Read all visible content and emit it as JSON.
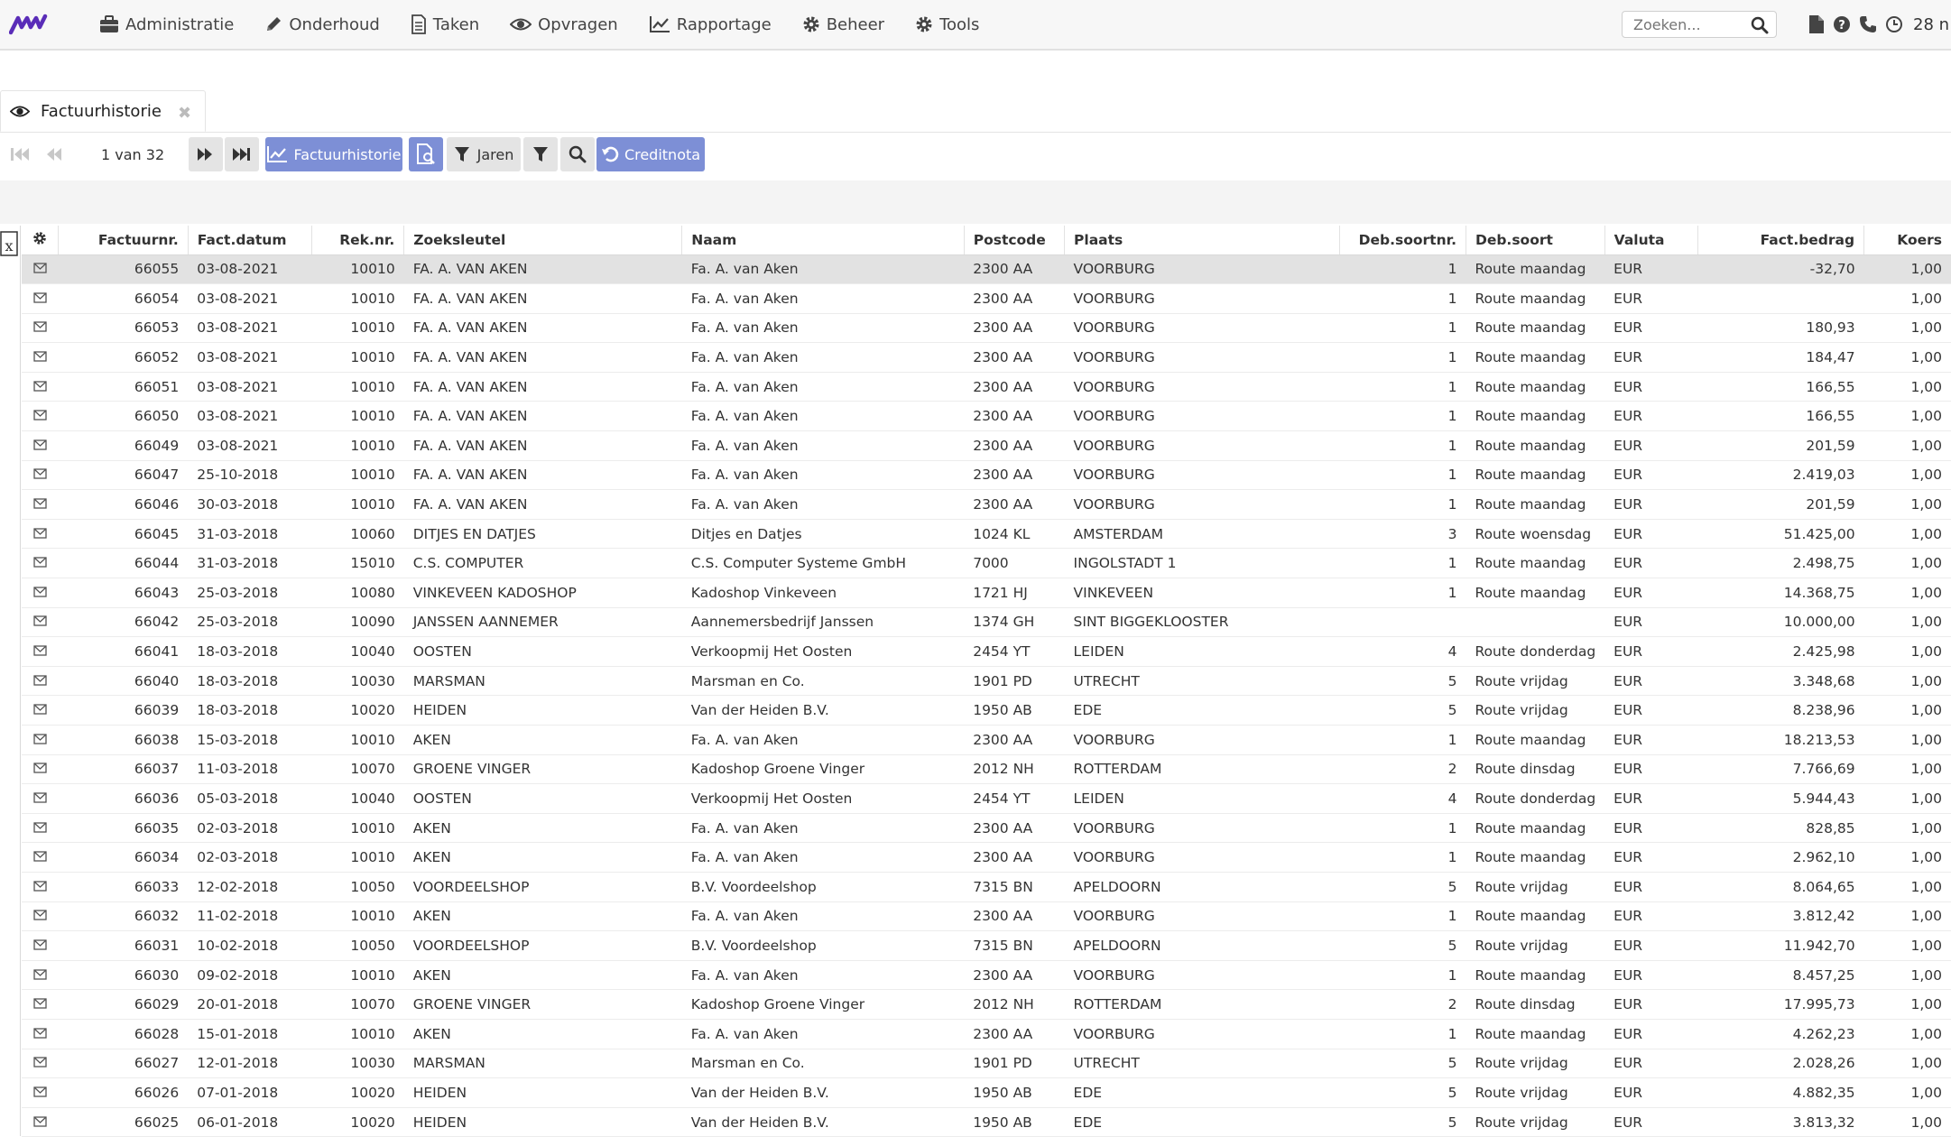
{
  "nav": {
    "items": [
      {
        "label": "Administratie",
        "icon": "briefcase-icon"
      },
      {
        "label": "Onderhoud",
        "icon": "pencil-icon"
      },
      {
        "label": "Taken",
        "icon": "document-icon"
      },
      {
        "label": "Opvragen",
        "icon": "eye-icon"
      },
      {
        "label": "Rapportage",
        "icon": "line-chart-icon"
      },
      {
        "label": "Beheer",
        "icon": "gear-icon"
      },
      {
        "label": "Tools",
        "icon": "gear-icon"
      }
    ],
    "search_placeholder": "Zoeken...",
    "clock_text": "28 n"
  },
  "tab": {
    "label": "Factuurhistorie"
  },
  "toolbar": {
    "page_info": "1 van 32",
    "report_button": "Factuurhistorie",
    "years_button": "Jaren",
    "credit_button": "Creditnota"
  },
  "table": {
    "columns": [
      "Factuurnr.",
      "Fact.datum",
      "Rek.nr.",
      "Zoeksleutel",
      "Naam",
      "Postcode",
      "Plaats",
      "Deb.soortnr.",
      "Deb.soort",
      "Valuta",
      "Fact.bedrag",
      "Koers"
    ],
    "rows": [
      [
        "66055",
        "03-08-2021",
        "10010",
        "FA. A. VAN AKEN",
        "Fa. A. van Aken",
        "2300 AA",
        "VOORBURG",
        "1",
        "Route maandag",
        "EUR",
        "-32,70",
        "1,00"
      ],
      [
        "66054",
        "03-08-2021",
        "10010",
        "FA. A. VAN AKEN",
        "Fa. A. van Aken",
        "2300 AA",
        "VOORBURG",
        "1",
        "Route maandag",
        "EUR",
        "",
        "1,00"
      ],
      [
        "66053",
        "03-08-2021",
        "10010",
        "FA. A. VAN AKEN",
        "Fa. A. van Aken",
        "2300 AA",
        "VOORBURG",
        "1",
        "Route maandag",
        "EUR",
        "180,93",
        "1,00"
      ],
      [
        "66052",
        "03-08-2021",
        "10010",
        "FA. A. VAN AKEN",
        "Fa. A. van Aken",
        "2300 AA",
        "VOORBURG",
        "1",
        "Route maandag",
        "EUR",
        "184,47",
        "1,00"
      ],
      [
        "66051",
        "03-08-2021",
        "10010",
        "FA. A. VAN AKEN",
        "Fa. A. van Aken",
        "2300 AA",
        "VOORBURG",
        "1",
        "Route maandag",
        "EUR",
        "166,55",
        "1,00"
      ],
      [
        "66050",
        "03-08-2021",
        "10010",
        "FA. A. VAN AKEN",
        "Fa. A. van Aken",
        "2300 AA",
        "VOORBURG",
        "1",
        "Route maandag",
        "EUR",
        "166,55",
        "1,00"
      ],
      [
        "66049",
        "03-08-2021",
        "10010",
        "FA. A. VAN AKEN",
        "Fa. A. van Aken",
        "2300 AA",
        "VOORBURG",
        "1",
        "Route maandag",
        "EUR",
        "201,59",
        "1,00"
      ],
      [
        "66047",
        "25-10-2018",
        "10010",
        "FA. A. VAN AKEN",
        "Fa. A. van Aken",
        "2300 AA",
        "VOORBURG",
        "1",
        "Route maandag",
        "EUR",
        "2.419,03",
        "1,00"
      ],
      [
        "66046",
        "30-03-2018",
        "10010",
        "FA. A. VAN AKEN",
        "Fa. A. van Aken",
        "2300 AA",
        "VOORBURG",
        "1",
        "Route maandag",
        "EUR",
        "201,59",
        "1,00"
      ],
      [
        "66045",
        "31-03-2018",
        "10060",
        "DITJES EN DATJES",
        "Ditjes en Datjes",
        "1024 KL",
        "AMSTERDAM",
        "3",
        "Route woensdag",
        "EUR",
        "51.425,00",
        "1,00"
      ],
      [
        "66044",
        "31-03-2018",
        "15010",
        "C.S. COMPUTER",
        "C.S. Computer Systeme GmbH",
        "7000",
        "INGOLSTADT 1",
        "1",
        "Route maandag",
        "EUR",
        "2.498,75",
        "1,00"
      ],
      [
        "66043",
        "25-03-2018",
        "10080",
        "VINKEVEEN KADOSHOP",
        "Kadoshop Vinkeveen",
        "1721 HJ",
        "VINKEVEEN",
        "1",
        "Route maandag",
        "EUR",
        "14.368,75",
        "1,00"
      ],
      [
        "66042",
        "25-03-2018",
        "10090",
        "JANSSEN AANNEMER",
        "Aannemersbedrijf Janssen",
        "1374 GH",
        "SINT BIGGEKLOOSTER",
        "",
        "",
        "EUR",
        "10.000,00",
        "1,00"
      ],
      [
        "66041",
        "18-03-2018",
        "10040",
        "OOSTEN",
        "Verkoopmij Het Oosten",
        "2454 YT",
        "LEIDEN",
        "4",
        "Route donderdag",
        "EUR",
        "2.425,98",
        "1,00"
      ],
      [
        "66040",
        "18-03-2018",
        "10030",
        "MARSMAN",
        "Marsman en Co.",
        "1901 PD",
        "UTRECHT",
        "5",
        "Route vrijdag",
        "EUR",
        "3.348,68",
        "1,00"
      ],
      [
        "66039",
        "18-03-2018",
        "10020",
        "HEIDEN",
        "Van der Heiden B.V.",
        "1950 AB",
        "EDE",
        "5",
        "Route vrijdag",
        "EUR",
        "8.238,96",
        "1,00"
      ],
      [
        "66038",
        "15-03-2018",
        "10010",
        "AKEN",
        "Fa. A. van Aken",
        "2300 AA",
        "VOORBURG",
        "1",
        "Route maandag",
        "EUR",
        "18.213,53",
        "1,00"
      ],
      [
        "66037",
        "11-03-2018",
        "10070",
        "GROENE VINGER",
        "Kadoshop Groene Vinger",
        "2012 NH",
        "ROTTERDAM",
        "2",
        "Route dinsdag",
        "EUR",
        "7.766,69",
        "1,00"
      ],
      [
        "66036",
        "05-03-2018",
        "10040",
        "OOSTEN",
        "Verkoopmij Het Oosten",
        "2454 YT",
        "LEIDEN",
        "4",
        "Route donderdag",
        "EUR",
        "5.944,43",
        "1,00"
      ],
      [
        "66035",
        "02-03-2018",
        "10010",
        "AKEN",
        "Fa. A. van Aken",
        "2300 AA",
        "VOORBURG",
        "1",
        "Route maandag",
        "EUR",
        "828,85",
        "1,00"
      ],
      [
        "66034",
        "02-03-2018",
        "10010",
        "AKEN",
        "Fa. A. van Aken",
        "2300 AA",
        "VOORBURG",
        "1",
        "Route maandag",
        "EUR",
        "2.962,10",
        "1,00"
      ],
      [
        "66033",
        "12-02-2018",
        "10050",
        "VOORDEELSHOP",
        "B.V. Voordeelshop",
        "7315 BN",
        "APELDOORN",
        "5",
        "Route vrijdag",
        "EUR",
        "8.064,65",
        "1,00"
      ],
      [
        "66032",
        "11-02-2018",
        "10010",
        "AKEN",
        "Fa. A. van Aken",
        "2300 AA",
        "VOORBURG",
        "1",
        "Route maandag",
        "EUR",
        "3.812,42",
        "1,00"
      ],
      [
        "66031",
        "10-02-2018",
        "10050",
        "VOORDEELSHOP",
        "B.V. Voordeelshop",
        "7315 BN",
        "APELDOORN",
        "5",
        "Route vrijdag",
        "EUR",
        "11.942,70",
        "1,00"
      ],
      [
        "66030",
        "09-02-2018",
        "10010",
        "AKEN",
        "Fa. A. van Aken",
        "2300 AA",
        "VOORBURG",
        "1",
        "Route maandag",
        "EUR",
        "8.457,25",
        "1,00"
      ],
      [
        "66029",
        "20-01-2018",
        "10070",
        "GROENE VINGER",
        "Kadoshop Groene Vinger",
        "2012 NH",
        "ROTTERDAM",
        "2",
        "Route dinsdag",
        "EUR",
        "17.995,73",
        "1,00"
      ],
      [
        "66028",
        "15-01-2018",
        "10010",
        "AKEN",
        "Fa. A. van Aken",
        "2300 AA",
        "VOORBURG",
        "1",
        "Route maandag",
        "EUR",
        "4.262,23",
        "1,00"
      ],
      [
        "66027",
        "12-01-2018",
        "10030",
        "MARSMAN",
        "Marsman en Co.",
        "1901 PD",
        "UTRECHT",
        "5",
        "Route vrijdag",
        "EUR",
        "2.028,26",
        "1,00"
      ],
      [
        "66026",
        "07-01-2018",
        "10020",
        "HEIDEN",
        "Van der Heiden B.V.",
        "1950 AB",
        "EDE",
        "5",
        "Route vrijdag",
        "EUR",
        "4.882,35",
        "1,00"
      ],
      [
        "66025",
        "06-01-2018",
        "10020",
        "HEIDEN",
        "Van der Heiden B.V.",
        "1950 AB",
        "EDE",
        "5",
        "Route vrijdag",
        "EUR",
        "3.813,32",
        "1,00"
      ]
    ]
  },
  "colors": {
    "accent": "#7d8fd6",
    "logo": "#5a2db8",
    "selected_row": "#e2e2e2"
  }
}
